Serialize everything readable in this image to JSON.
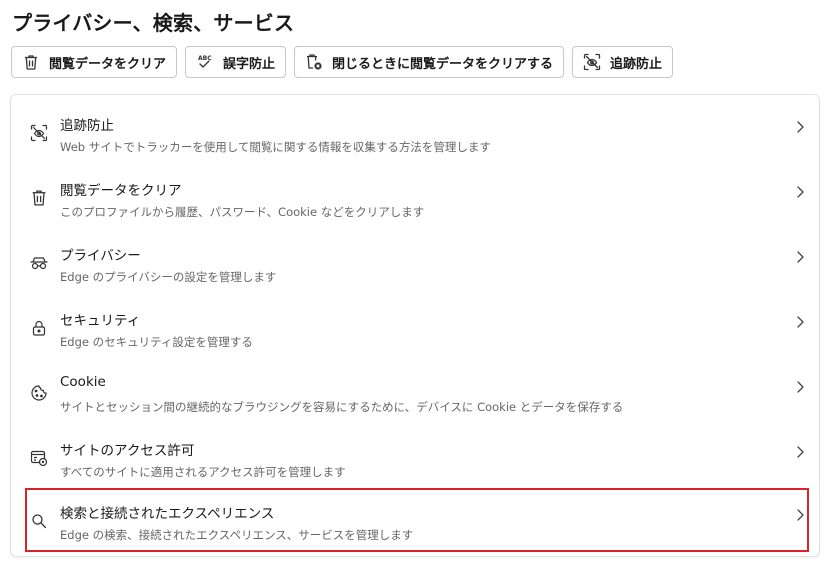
{
  "page": {
    "title": "プライバシー、検索、サービス"
  },
  "quick_actions": [
    {
      "label": "閲覧データをクリア",
      "icon": "trash-icon"
    },
    {
      "label": "誤字防止",
      "icon": "spellcheck-icon"
    },
    {
      "label": "閉じるときに閲覧データをクリアする",
      "icon": "trash-clock-icon"
    },
    {
      "label": "追跡防止",
      "icon": "tracking-prevention-icon"
    }
  ],
  "settings": [
    {
      "title": "追跡防止",
      "desc": "Web サイトでトラッカーを使用して閲覧に関する情報を収集する方法を管理します",
      "icon": "tracking-prevention-icon"
    },
    {
      "title": "閲覧データをクリア",
      "desc": "このプロファイルから履歴、パスワード、Cookie などをクリアします",
      "icon": "trash-icon"
    },
    {
      "title": "プライバシー",
      "desc": "Edge のプライバシーの設定を管理します",
      "icon": "glasses-icon"
    },
    {
      "title": "セキュリティ",
      "desc": "Edge のセキュリティ設定を管理する",
      "icon": "lock-icon"
    },
    {
      "title": "Cookie",
      "desc": "サイトとセッション間の継続的なブラウジングを容易にするために、デバイスに Cookie とデータを保存する",
      "icon": "cookie-icon"
    },
    {
      "title": "サイトのアクセス許可",
      "desc": "すべてのサイトに適用されるアクセス許可を管理します",
      "icon": "site-permissions-icon"
    },
    {
      "title": "検索と接続されたエクスペリエンス",
      "desc": "Edge の検索、接続されたエクスペリエンス、サービスを管理します",
      "icon": "search-icon"
    }
  ],
  "highlight_color": "#d8232a"
}
